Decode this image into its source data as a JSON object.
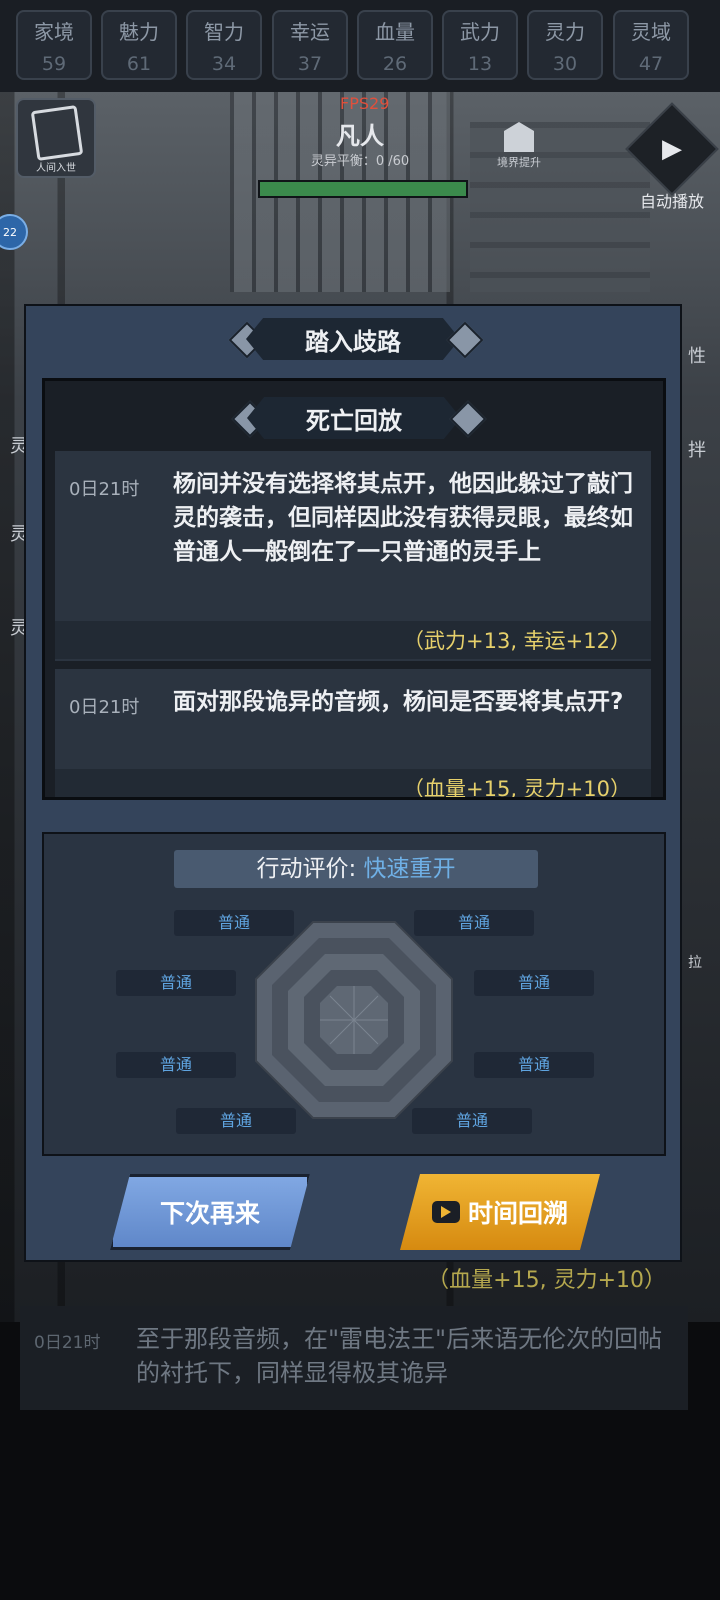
{
  "stats": [
    {
      "name": "家境",
      "value": "59"
    },
    {
      "name": "魅力",
      "value": "61"
    },
    {
      "name": "智力",
      "value": "34"
    },
    {
      "name": "幸运",
      "value": "37"
    },
    {
      "name": "血量",
      "value": "26"
    },
    {
      "name": "武力",
      "value": "13"
    },
    {
      "name": "灵力",
      "value": "30"
    },
    {
      "name": "灵域",
      "value": "47"
    }
  ],
  "hud": {
    "fps": "FPS29",
    "realm": "凡人",
    "balance_label": "灵异平衡：0 /60",
    "left_icon_label": "人间入世",
    "side_badge": "22",
    "realm_up_label": "境界提升",
    "autoplay_label": "自动播放",
    "right_edge_1": "性",
    "right_edge_2": "拌",
    "right_edge_3": "拉",
    "left_edge_1": "灵",
    "left_edge_2": "灵",
    "left_edge_3": "灵"
  },
  "background_log": {
    "reward": "（血量+15, 灵力+10）",
    "time": "0日21时",
    "text": "至于那段音频，在\"雷电法王\"后来语无伦次的回帖的衬托下，同样显得极其诡异"
  },
  "modal": {
    "title": "踏入歧路",
    "story_title": "死亡回放",
    "entries": [
      {
        "time": "0日21时",
        "text": "杨间并没有选择将其点开，他因此躲过了敲门灵的袭击，但同样因此没有获得灵眼，最终如普通人一般倒在了一只普通的灵手上",
        "reward": "（武力+13, 幸运+12）"
      },
      {
        "time": "0日21时",
        "text": "面对那段诡异的音频，杨间是否要将其点开?",
        "reward": "（血量+15, 灵力+10）"
      }
    ],
    "eval_label": "行动评价: ",
    "eval_value": "快速重开",
    "ratings": [
      "普通",
      "普通",
      "普通",
      "普通",
      "普通",
      "普通",
      "普通",
      "普通"
    ],
    "button_next": "下次再来",
    "button_rewind": "时间回溯"
  }
}
